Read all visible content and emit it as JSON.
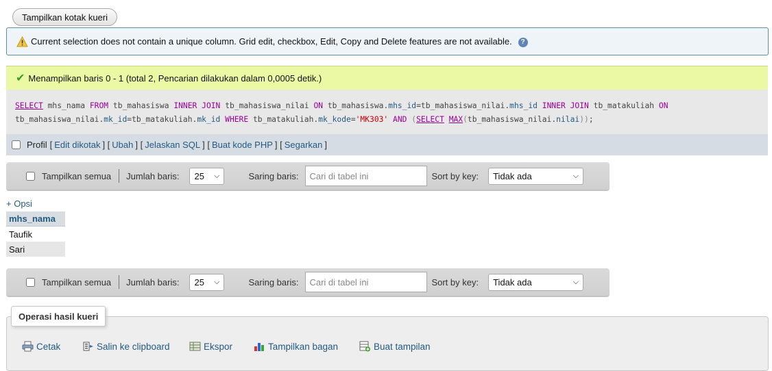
{
  "query_box_button": "Tampilkan kotak kueri",
  "notice": {
    "text": "Current selection does not contain a unique column. Grid edit, checkbox, Edit, Copy and Delete features are not available.",
    "help_glyph": "?"
  },
  "success": {
    "icon": "✔",
    "text": "Menampilkan baris 0 - 1 (total 2, Pencarian dilakukan dalam 0,0005 detik.)"
  },
  "sql": "SELECT mhs_nama FROM tb_mahasiswa INNER JOIN tb_mahasiswa_nilai ON tb_mahasiswa.mhs_id=tb_mahasiswa_nilai.mhs_id INNER JOIN tb_matakuliah ON tb_mahasiswa_nilai.mk_id=tb_matakuliah.mk_id WHERE tb_matakuliah.mk_kode='MK303' AND (SELECT MAX(tb_mahasiswa_nilai.nilai));",
  "profile": {
    "label": "Profil",
    "links": [
      "Edit dikotak",
      "Ubah",
      "Jelaskan SQL",
      "Buat kode PHP",
      "Segarkan"
    ],
    "bracket_open": "[",
    "bracket_close": "]",
    "bracket_join": "] ["
  },
  "navigation": {
    "show_all": "Tampilkan semua",
    "rows_label": "Jumlah baris:",
    "rows_value": "25",
    "filter_label": "Saring baris:",
    "filter_placeholder": "Cari di tabel ini",
    "sort_label": "Sort by key:",
    "sort_value": "Tidak ada",
    "dropdown_arrow": "⌵"
  },
  "options_link": "+ Opsi",
  "results": {
    "columns": [
      "mhs_nama"
    ],
    "rows": [
      [
        "Taufik"
      ],
      [
        "Sari"
      ]
    ]
  },
  "operations": {
    "legend": "Operasi hasil kueri",
    "items": [
      "Cetak",
      "Salin ke clipboard",
      "Ekspor",
      "Tampilkan bagan",
      "Buat tampilan"
    ]
  },
  "colors": {
    "link": "#235a81",
    "success_bg": "#ebf8a4",
    "notice_border": "#5d8fa6",
    "sql_keyword": "#990099",
    "sql_string": "#cc0000"
  }
}
